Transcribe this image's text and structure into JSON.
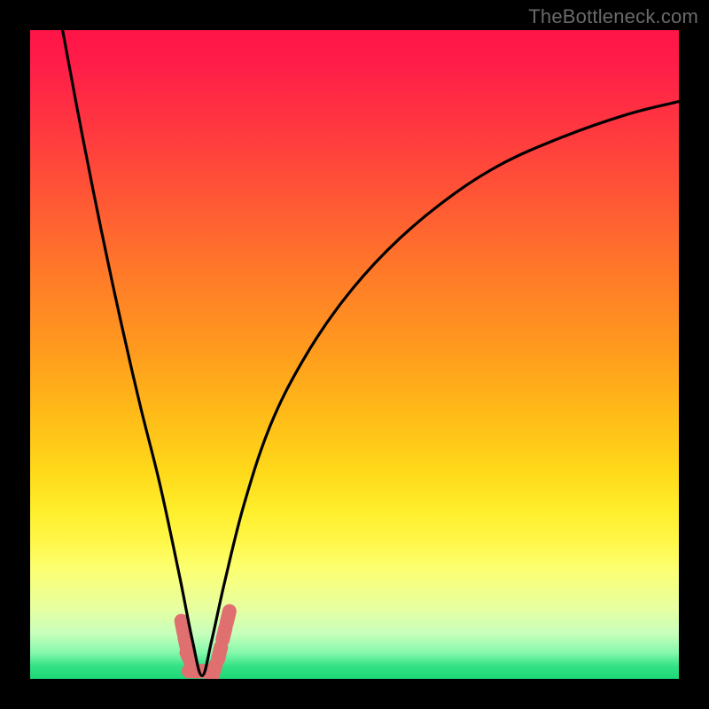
{
  "watermark": {
    "text": "TheBottleneck.com"
  },
  "colors": {
    "background": "#000000",
    "curve_stroke": "#000000",
    "marker_fill": "#e07070",
    "marker_stroke": "#d86262"
  },
  "chart_data": {
    "type": "line",
    "title": "",
    "xlabel": "",
    "ylabel": "",
    "xlim": [
      0,
      100
    ],
    "ylim": [
      0,
      100
    ],
    "grid": false,
    "notes": "V-shaped bottleneck curve on red→green vertical gradient. Minimum (~0%) near x≈26.5. Low values are good (green bottom), high values bad (red top). Axes are unlabeled in the source image; numeric values below are eyeballed from pixel positions on a 0–100 normalized coordinate system (origin bottom-left).",
    "series": [
      {
        "name": "bottleneck-curve",
        "x": [
          5,
          8,
          11,
          14,
          17,
          20,
          23,
          25,
          26.5,
          28,
          30,
          33,
          37,
          42,
          48,
          55,
          63,
          72,
          82,
          92,
          100
        ],
        "values": [
          100,
          84,
          69,
          55,
          42,
          30,
          16,
          6,
          0.5,
          6,
          15,
          27,
          39,
          49,
          58,
          66,
          73,
          79,
          83.5,
          87,
          89
        ]
      }
    ],
    "markers": {
      "name": "valley-markers",
      "description": "Pink rounded-cap segments tracing the valley floor around the minimum.",
      "points": [
        {
          "x": 23.5,
          "y": 8.0
        },
        {
          "x": 24.0,
          "y": 5.5
        },
        {
          "x": 24.5,
          "y": 3.2
        },
        {
          "x": 25.4,
          "y": 1.2
        },
        {
          "x": 27.0,
          "y": 1.2
        },
        {
          "x": 28.3,
          "y": 1.2
        },
        {
          "x": 29.2,
          "y": 4.0
        },
        {
          "x": 29.9,
          "y": 7.0
        },
        {
          "x": 30.5,
          "y": 9.5
        }
      ]
    }
  }
}
